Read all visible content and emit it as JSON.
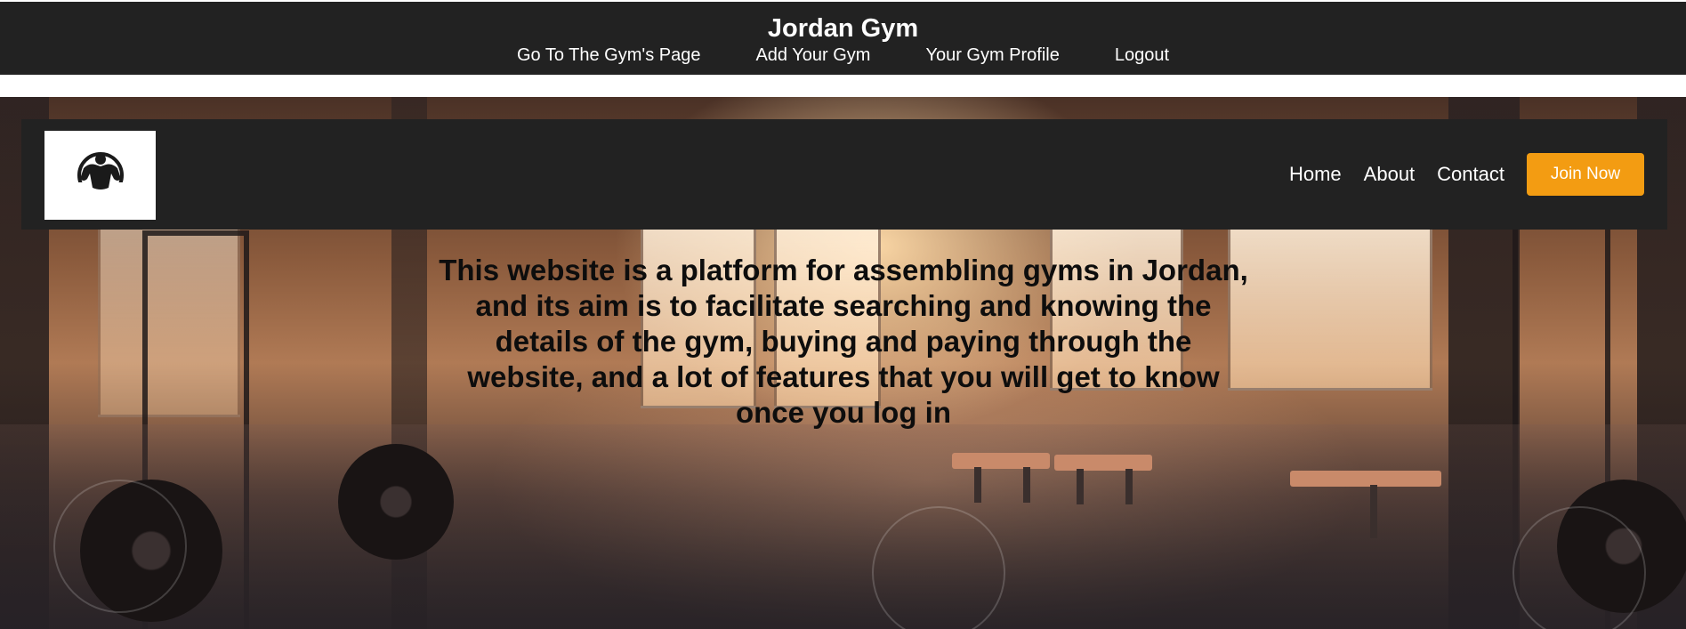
{
  "top_header": {
    "title": "Jordan Gym",
    "nav": [
      {
        "label": "Go To The Gym's Page"
      },
      {
        "label": "Add Your Gym"
      },
      {
        "label": "Your Gym Profile"
      },
      {
        "label": "Logout"
      }
    ]
  },
  "main_nav": {
    "logo_icon": "bodybuilder-logo-icon",
    "links": [
      {
        "label": "Home"
      },
      {
        "label": "About"
      },
      {
        "label": "Contact"
      }
    ],
    "cta_label": "Join Now"
  },
  "hero": {
    "text": "This website is a platform for assembling gyms in Jordan, and its aim is to facilitate searching and knowing the details of the gym, buying and paying through the website, and a lot of features that you will get to know once you log in"
  },
  "colors": {
    "header_bg": "#222222",
    "accent": "#f39c12",
    "text_light": "#ffffff"
  }
}
